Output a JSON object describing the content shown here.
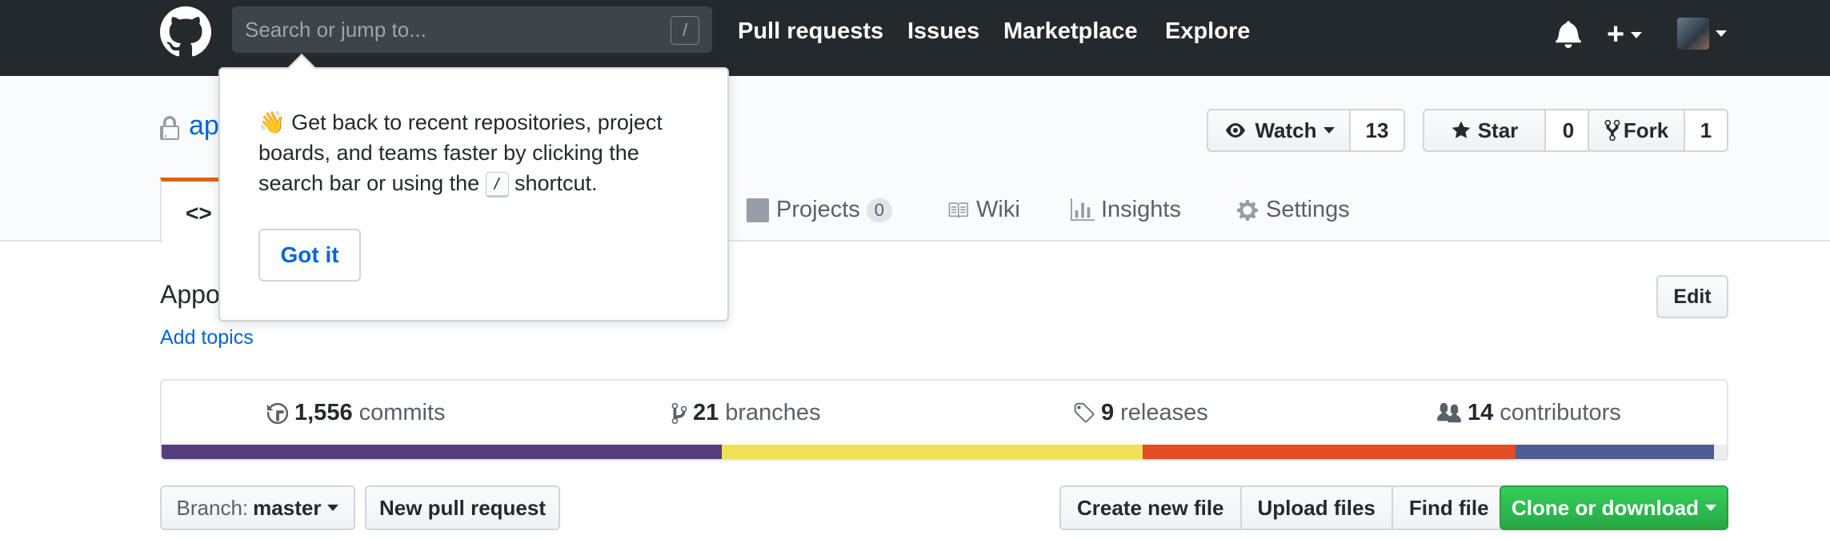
{
  "header": {
    "search_placeholder": "Search or jump to...",
    "search_shortcut": "/",
    "nav": [
      "Pull requests",
      "Issues",
      "Marketplace",
      "Explore"
    ],
    "icons": [
      "github-logo-icon",
      "bell-icon",
      "plus-icon",
      "avatar"
    ]
  },
  "repo": {
    "name": "ap",
    "watch": {
      "label": "Watch",
      "count": "13"
    },
    "star": {
      "label": "Star",
      "count": "0"
    },
    "fork": {
      "label": "Fork",
      "count": "1"
    }
  },
  "tabs": {
    "code_icon": "<>",
    "projects": {
      "label": "Projects",
      "count": "0"
    },
    "wiki": "Wiki",
    "insights": "Insights",
    "settings": "Settings"
  },
  "description": {
    "text": "Appo",
    "add_topics": "Add topics",
    "edit": "Edit"
  },
  "summary": {
    "commits": {
      "count": "1,556",
      "label": "commits"
    },
    "branches": {
      "count": "21",
      "label": "branches"
    },
    "releases": {
      "count": "9",
      "label": "releases"
    },
    "contributors": {
      "count": "14",
      "label": "contributors"
    },
    "languages": [
      {
        "color": "#563d7c",
        "fraction": 0.358
      },
      {
        "color": "#f1e05a",
        "fraction": 0.269
      },
      {
        "color": "#e34c26",
        "fraction": 0.238
      },
      {
        "color": "#4f5d95",
        "fraction": 0.127
      },
      {
        "color": "#ededed",
        "fraction": 0.008
      }
    ]
  },
  "file_nav": {
    "branch_prefix": "Branch:",
    "branch_name": "master",
    "new_pr": "New pull request",
    "create_file": "Create new file",
    "upload_files": "Upload files",
    "find_file": "Find file",
    "clone": "Clone or download"
  },
  "popover": {
    "emoji": "👋",
    "text_1": " Get back to recent repositories, project boards, and teams faster by clicking the search bar or using the ",
    "kbd": "/",
    "text_2": " shortcut.",
    "button": "Got it"
  }
}
